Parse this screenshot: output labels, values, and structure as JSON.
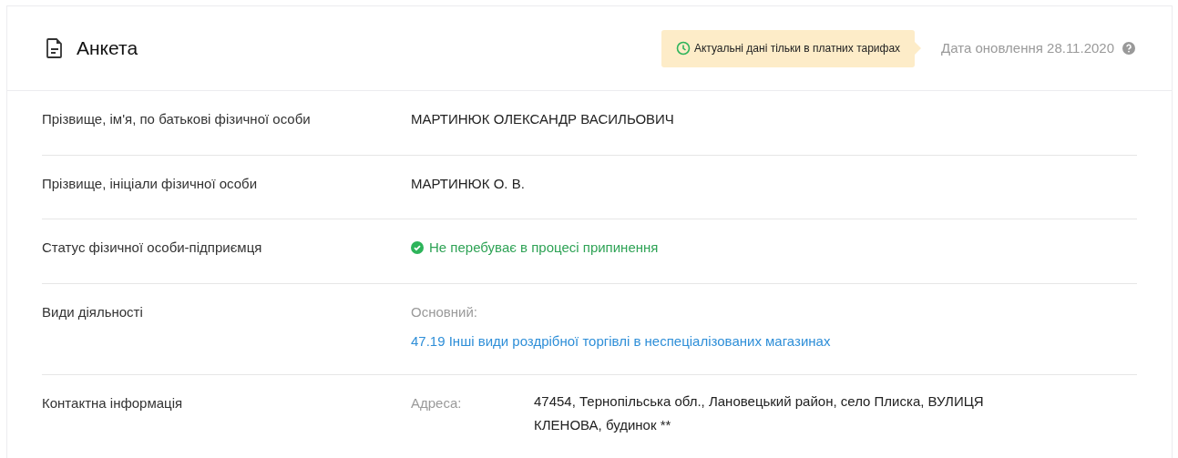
{
  "header": {
    "title": "Анкета",
    "notice": "Актуальні дані тільки в платних тарифах",
    "updated": "Дата оновлення 28.11.2020"
  },
  "rows": [
    {
      "kind": "text",
      "label": "Прізвище, ім'я, по батькові фізичної особи",
      "value": "МАРТИНЮК ОЛЕКСАНДР ВАСИЛЬОВИЧ"
    },
    {
      "kind": "text",
      "label": "Прізвище, ініціали фізичної особи",
      "value": "МАРТИНЮК О. В."
    },
    {
      "kind": "status",
      "label": "Статус фізичної особи-підприємця",
      "value": "Не перебуває в процесі припинення"
    },
    {
      "kind": "activity",
      "label": "Види діяльності",
      "caption": "Основний:",
      "value": "47.19 Інші види роздрібної торгівлі в неспеціалізованих магазинах"
    },
    {
      "kind": "contact",
      "label": "Контактна інформація",
      "caption": "Адреса:",
      "value": "47454, Тернопільська обл., Лановецький район, село Плиска, ВУЛИЦЯ КЛЕНОВА, будинок **"
    }
  ]
}
